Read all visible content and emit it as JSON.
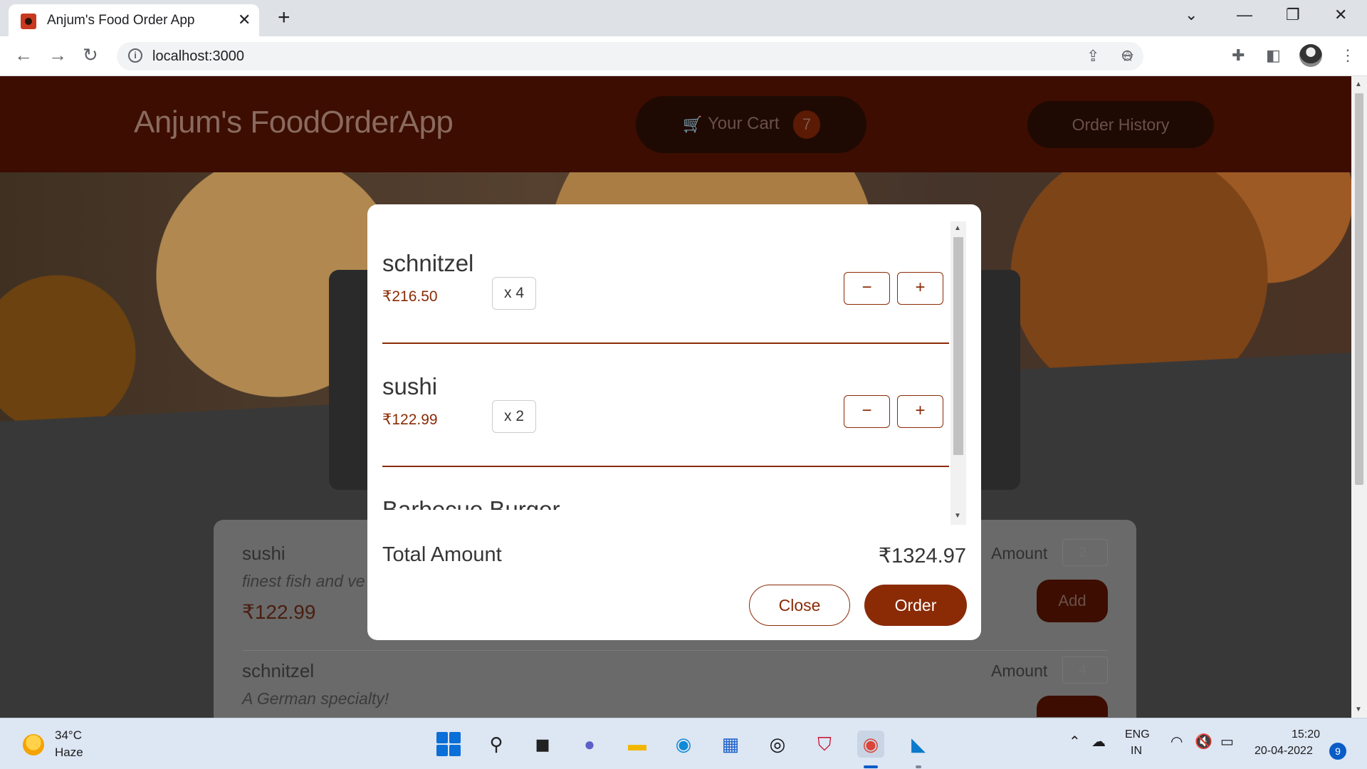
{
  "browser": {
    "tab_title": "Anjum's Food Order App",
    "tab_close": "✕",
    "new_tab": "+",
    "url": "localhost:3000",
    "info_glyph": "i"
  },
  "app": {
    "brand": "Anjum's FoodOrderApp",
    "cart_label": "Your Cart",
    "cart_count": "7",
    "history_label": "Order History"
  },
  "background_meals": [
    {
      "name": "sushi",
      "description": "finest fish and ve",
      "price": "₹122.99",
      "amount_label": "Amount",
      "amount_value": "2",
      "add_label": "Add"
    },
    {
      "name": "schnitzel",
      "description": "A German specialty!",
      "amount_label": "Amount",
      "amount_value": "4"
    }
  ],
  "cart_modal": {
    "items": [
      {
        "name": "schnitzel",
        "price": "₹216.50",
        "quantity": "x 4",
        "minus": "−",
        "plus": "+"
      },
      {
        "name": "sushi",
        "price": "₹122.99",
        "quantity": "x 2",
        "minus": "−",
        "plus": "+"
      },
      {
        "name": "Barbecue Burger",
        "minus": "−",
        "plus": "+"
      }
    ],
    "total_label": "Total Amount",
    "total_value": "₹1324.97",
    "close_label": "Close",
    "order_label": "Order"
  },
  "taskbar": {
    "weather_temp": "34°C",
    "weather_desc": "Haze",
    "lang_line1": "ENG",
    "lang_line2": "IN",
    "time": "15:20",
    "date": "20-04-2022",
    "notification_count": "9"
  },
  "colors": {
    "accent": "#8a2b06",
    "header_bg": "#3c0d00"
  }
}
